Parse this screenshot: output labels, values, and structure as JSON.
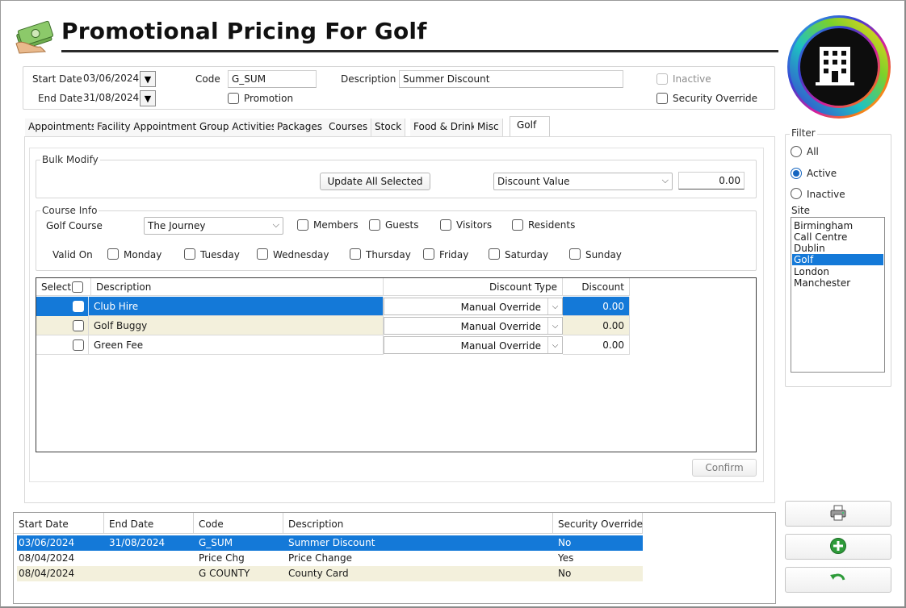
{
  "header": {
    "title": "Promotional Pricing For Golf",
    "logo_icon": "money-stack-icon",
    "brand_icon": "building-icon"
  },
  "form": {
    "start_date_label": "Start Date",
    "start_date": "03/06/2024",
    "end_date_label": "End Date",
    "end_date": "31/08/2024",
    "code_label": "Code",
    "code": "G_SUM",
    "promotion_label": "Promotion",
    "description_label": "Description",
    "description": "Summer Discount",
    "inactive_label": "Inactive",
    "security_override_label": "Security Override"
  },
  "tabs": [
    {
      "label": "Appointments"
    },
    {
      "label": "Facility Appointments"
    },
    {
      "label": "Group Activities"
    },
    {
      "label": "Packages"
    },
    {
      "label": "Courses"
    },
    {
      "label": "Stock"
    },
    {
      "label": "Food & Drink"
    },
    {
      "label": "Misc"
    },
    {
      "label": "Golf"
    }
  ],
  "bulk": {
    "title": "Bulk Modify",
    "update_button": "Update All Selected",
    "discount_select": "Discount Value",
    "discount_value": "0.00"
  },
  "course_info": {
    "title": "Course Info",
    "golf_course_label": "Golf Course",
    "golf_course": "The Journey",
    "members": "Members",
    "guests": "Guests",
    "visitors": "Visitors",
    "residents": "Residents",
    "valid_on_label": "Valid On",
    "days": [
      "Monday",
      "Tuesday",
      "Wednesday",
      "Thursday",
      "Friday",
      "Saturday",
      "Sunday"
    ]
  },
  "grid": {
    "headers": {
      "select": "Select",
      "description": "Description",
      "discount_type": "Discount Type",
      "discount": "Discount"
    },
    "rows": [
      {
        "description": "Club Hire",
        "discount_type": "Manual Override",
        "discount": "0.00"
      },
      {
        "description": "Golf Buggy",
        "discount_type": "Manual Override",
        "discount": "0.00"
      },
      {
        "description": "Green Fee",
        "discount_type": "Manual Override",
        "discount": "0.00"
      }
    ],
    "confirm_button": "Confirm"
  },
  "filter": {
    "title": "Filter",
    "all": "All",
    "active": "Active",
    "inactive": "Inactive",
    "site_label": "Site",
    "sites": [
      "Birmingham",
      "Call Centre",
      "Dublin",
      "Golf",
      "London",
      "Manchester"
    ],
    "selected_site": "Golf"
  },
  "promotions": {
    "headers": {
      "start": "Start Date",
      "end": "End Date",
      "code": "Code",
      "description": "Description",
      "security": "Security Override"
    },
    "rows": [
      {
        "start": "03/06/2024",
        "end": "31/08/2024",
        "code": "G_SUM",
        "description": "Summer Discount",
        "security": "No"
      },
      {
        "start": "08/04/2024",
        "end": "",
        "code": "Price Chg",
        "description": "Price Change",
        "security": "Yes"
      },
      {
        "start": "08/04/2024",
        "end": "",
        "code": "G COUNTY",
        "description": "County Card",
        "security": "No"
      }
    ]
  },
  "side_buttons": {
    "print_icon": "printer-icon",
    "add_icon": "add-icon",
    "undo_icon": "undo-icon"
  },
  "colors": {
    "selection": "#1479d8",
    "alt_row": "#f3f0dc",
    "add_green": "#2e9b3a"
  }
}
